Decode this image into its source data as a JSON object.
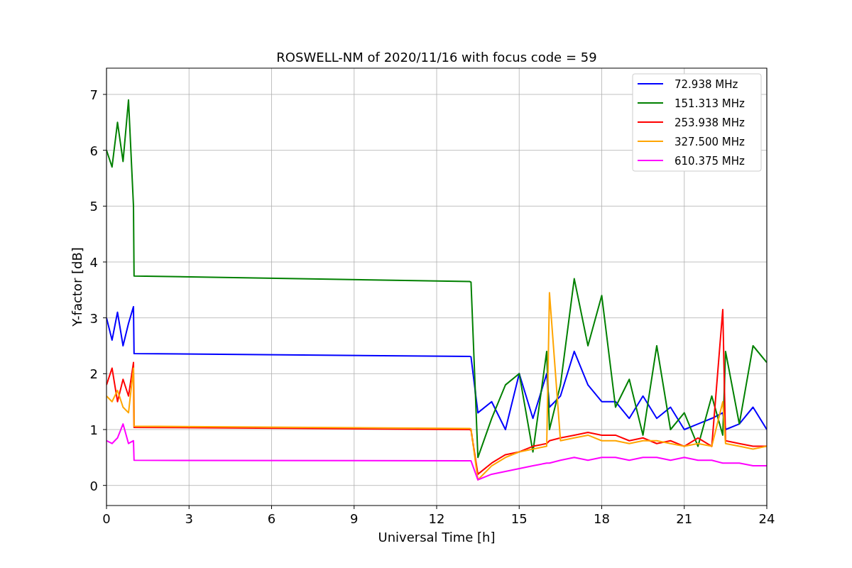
{
  "chart_data": {
    "type": "line",
    "title": "ROSWELL-NM of 2020/11/16 with focus code = 59",
    "xlabel": "Universal Time [h]",
    "ylabel": "Y-factor [dB]",
    "x": [
      0,
      0.2,
      0.4,
      0.6,
      0.8,
      0.98,
      1.0,
      13.2,
      13.25,
      13.5,
      14,
      14.5,
      15,
      15.5,
      16,
      16.1,
      16.5,
      17,
      17.5,
      18,
      18.5,
      19,
      19.5,
      20,
      20.5,
      21,
      21.5,
      22,
      22.4,
      22.5,
      23,
      23.5,
      24
    ],
    "series": [
      {
        "name": "72.938 MHz",
        "color": "#0000ff",
        "values": [
          3.0,
          2.6,
          3.1,
          2.5,
          2.9,
          3.2,
          2.36,
          2.31,
          2.3,
          1.3,
          1.5,
          1.0,
          2.0,
          1.2,
          2.0,
          1.4,
          1.6,
          2.4,
          1.8,
          1.5,
          1.5,
          1.2,
          1.6,
          1.2,
          1.4,
          1.0,
          1.1,
          1.2,
          1.3,
          1.0,
          1.1,
          1.4,
          1.0
        ]
      },
      {
        "name": "151.313 MHz",
        "color": "#008000",
        "values": [
          6.0,
          5.7,
          6.5,
          5.8,
          6.9,
          5.0,
          3.75,
          3.65,
          3.64,
          0.5,
          1.2,
          1.8,
          2.0,
          0.6,
          2.4,
          1.0,
          1.8,
          3.7,
          2.5,
          3.4,
          1.4,
          1.9,
          0.9,
          2.5,
          1.0,
          1.3,
          0.7,
          1.6,
          0.9,
          2.4,
          1.1,
          2.5,
          2.2
        ]
      },
      {
        "name": "253.938 MHz",
        "color": "#ff0000",
        "values": [
          1.8,
          2.1,
          1.5,
          1.9,
          1.6,
          2.2,
          1.04,
          1.0,
          0.99,
          0.2,
          0.4,
          0.55,
          0.6,
          0.7,
          0.75,
          0.8,
          0.85,
          0.9,
          0.95,
          0.9,
          0.9,
          0.8,
          0.85,
          0.75,
          0.8,
          0.7,
          0.85,
          0.7,
          3.15,
          0.8,
          0.75,
          0.7,
          0.7
        ]
      },
      {
        "name": "327.500 MHz",
        "color": "#ffa500",
        "values": [
          1.6,
          1.5,
          1.7,
          1.4,
          1.3,
          2.1,
          1.06,
          1.02,
          1.01,
          0.1,
          0.35,
          0.5,
          0.6,
          0.65,
          0.7,
          3.45,
          0.8,
          0.85,
          0.9,
          0.8,
          0.8,
          0.75,
          0.8,
          0.8,
          0.75,
          0.7,
          0.75,
          0.7,
          1.5,
          0.75,
          0.7,
          0.65,
          0.7
        ]
      },
      {
        "name": "610.375 MHz",
        "color": "#ff00ff",
        "values": [
          0.8,
          0.75,
          0.85,
          1.1,
          0.75,
          0.8,
          0.45,
          0.44,
          0.44,
          0.1,
          0.2,
          0.25,
          0.3,
          0.35,
          0.4,
          0.4,
          0.45,
          0.5,
          0.45,
          0.5,
          0.5,
          0.45,
          0.5,
          0.5,
          0.45,
          0.5,
          0.45,
          0.45,
          0.4,
          0.4,
          0.4,
          0.35,
          0.35
        ]
      }
    ],
    "xlim": [
      0,
      24
    ],
    "ylim": [
      -0.36,
      7.47
    ],
    "xticks": [
      0,
      3,
      6,
      9,
      12,
      15,
      18,
      21,
      24
    ],
    "yticks": [
      0,
      1,
      2,
      3,
      4,
      5,
      6,
      7
    ],
    "grid": true,
    "legend": true
  }
}
